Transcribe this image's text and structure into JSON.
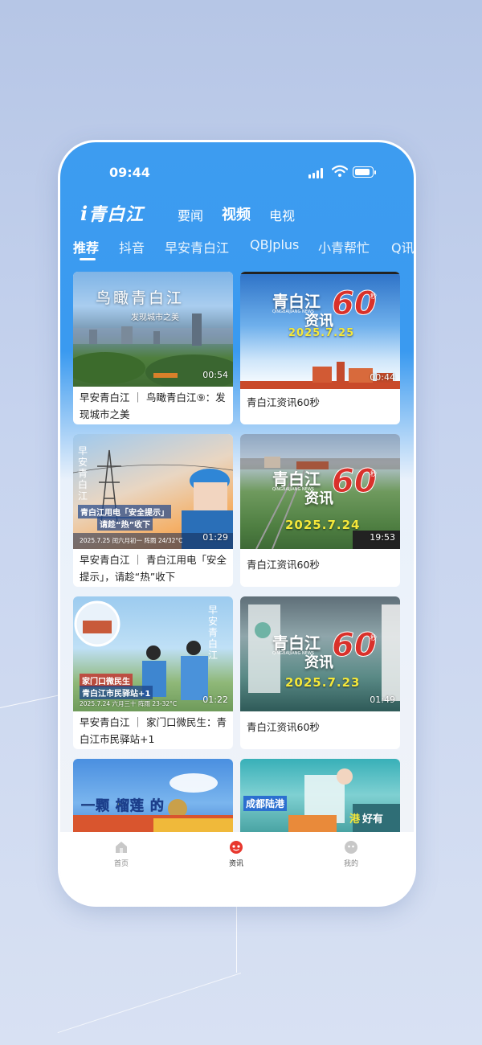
{
  "status_bar": {
    "time": "09:44"
  },
  "header": {
    "logo": "青白江",
    "nav": [
      "要闻",
      "视频",
      "电视"
    ],
    "active_nav": "视频"
  },
  "tabs": [
    "推荐",
    "抖音",
    "早安青白江",
    "QBJplus",
    "小青帮忙",
    "Q讯"
  ],
  "cards": [
    {
      "title": "早安青白江 ｜ 鸟瞰青白江⑨：发现城市之美",
      "duration": "00:54",
      "overlay": "鸟瞰青白江",
      "overlay_sub": "发现城市之美"
    },
    {
      "title": "青白江资讯60秒",
      "duration": "00:44",
      "news_brand": "青白江",
      "news_sub": "资讯",
      "news_60": "60",
      "news_sec": "秒",
      "news_en": "QINGBAIJIANG NEWS",
      "date": "2025.7.25"
    },
    {
      "title": "早安青白江 ｜ 青白江用电「安全提示」，请趁“热”收下",
      "duration": "01:29",
      "overlay_brand": "早安青白江",
      "overlay": "青白江用电「安全提示」",
      "overlay_sub": "请趁“热”收下",
      "caption": "2025.7.25 闰六月初一 阵雨 24/32°C"
    },
    {
      "title": "青白江资讯60秒",
      "duration": "19:53",
      "news_brand": "青白江",
      "news_sub": "资讯",
      "news_60": "60",
      "news_sec": "秒",
      "news_en": "QINGBAIJIANG NEWS",
      "date": "2025.7.24"
    },
    {
      "title": "早安青白江 ｜ 家门口微民生：青白江市民驿站+1",
      "duration": "01:22",
      "overlay_brand": "早安青白江",
      "overlay": "家门口微民生",
      "overlay_sub": "青白江市民驿站+1",
      "caption": "2025.7.24 六月三十 阵雨 23-32°C"
    },
    {
      "title": "青白江资讯60秒",
      "duration": "01:49",
      "news_brand": "青白江",
      "news_sub": "资讯",
      "news_60": "60",
      "news_sec": "秒",
      "news_en": "QINGBAIJIANG NEWS",
      "date": "2025.7.23"
    },
    {
      "title": "",
      "overlay": "一颗 榴莲 的"
    },
    {
      "title": "",
      "overlay": "成都陆港",
      "overlay_sub": "好有",
      "overlay_hl": "港"
    }
  ],
  "bottom_nav": [
    {
      "label": "首页",
      "icon": "home-icon",
      "active": false
    },
    {
      "label": "资讯",
      "icon": "news-icon",
      "active": true
    },
    {
      "label": "我的",
      "icon": "profile-icon",
      "active": false
    }
  ],
  "colors": {
    "primary_blue": "#3d9cf0",
    "news_red": "#d9312b",
    "news_yellow": "#f5e83a"
  }
}
